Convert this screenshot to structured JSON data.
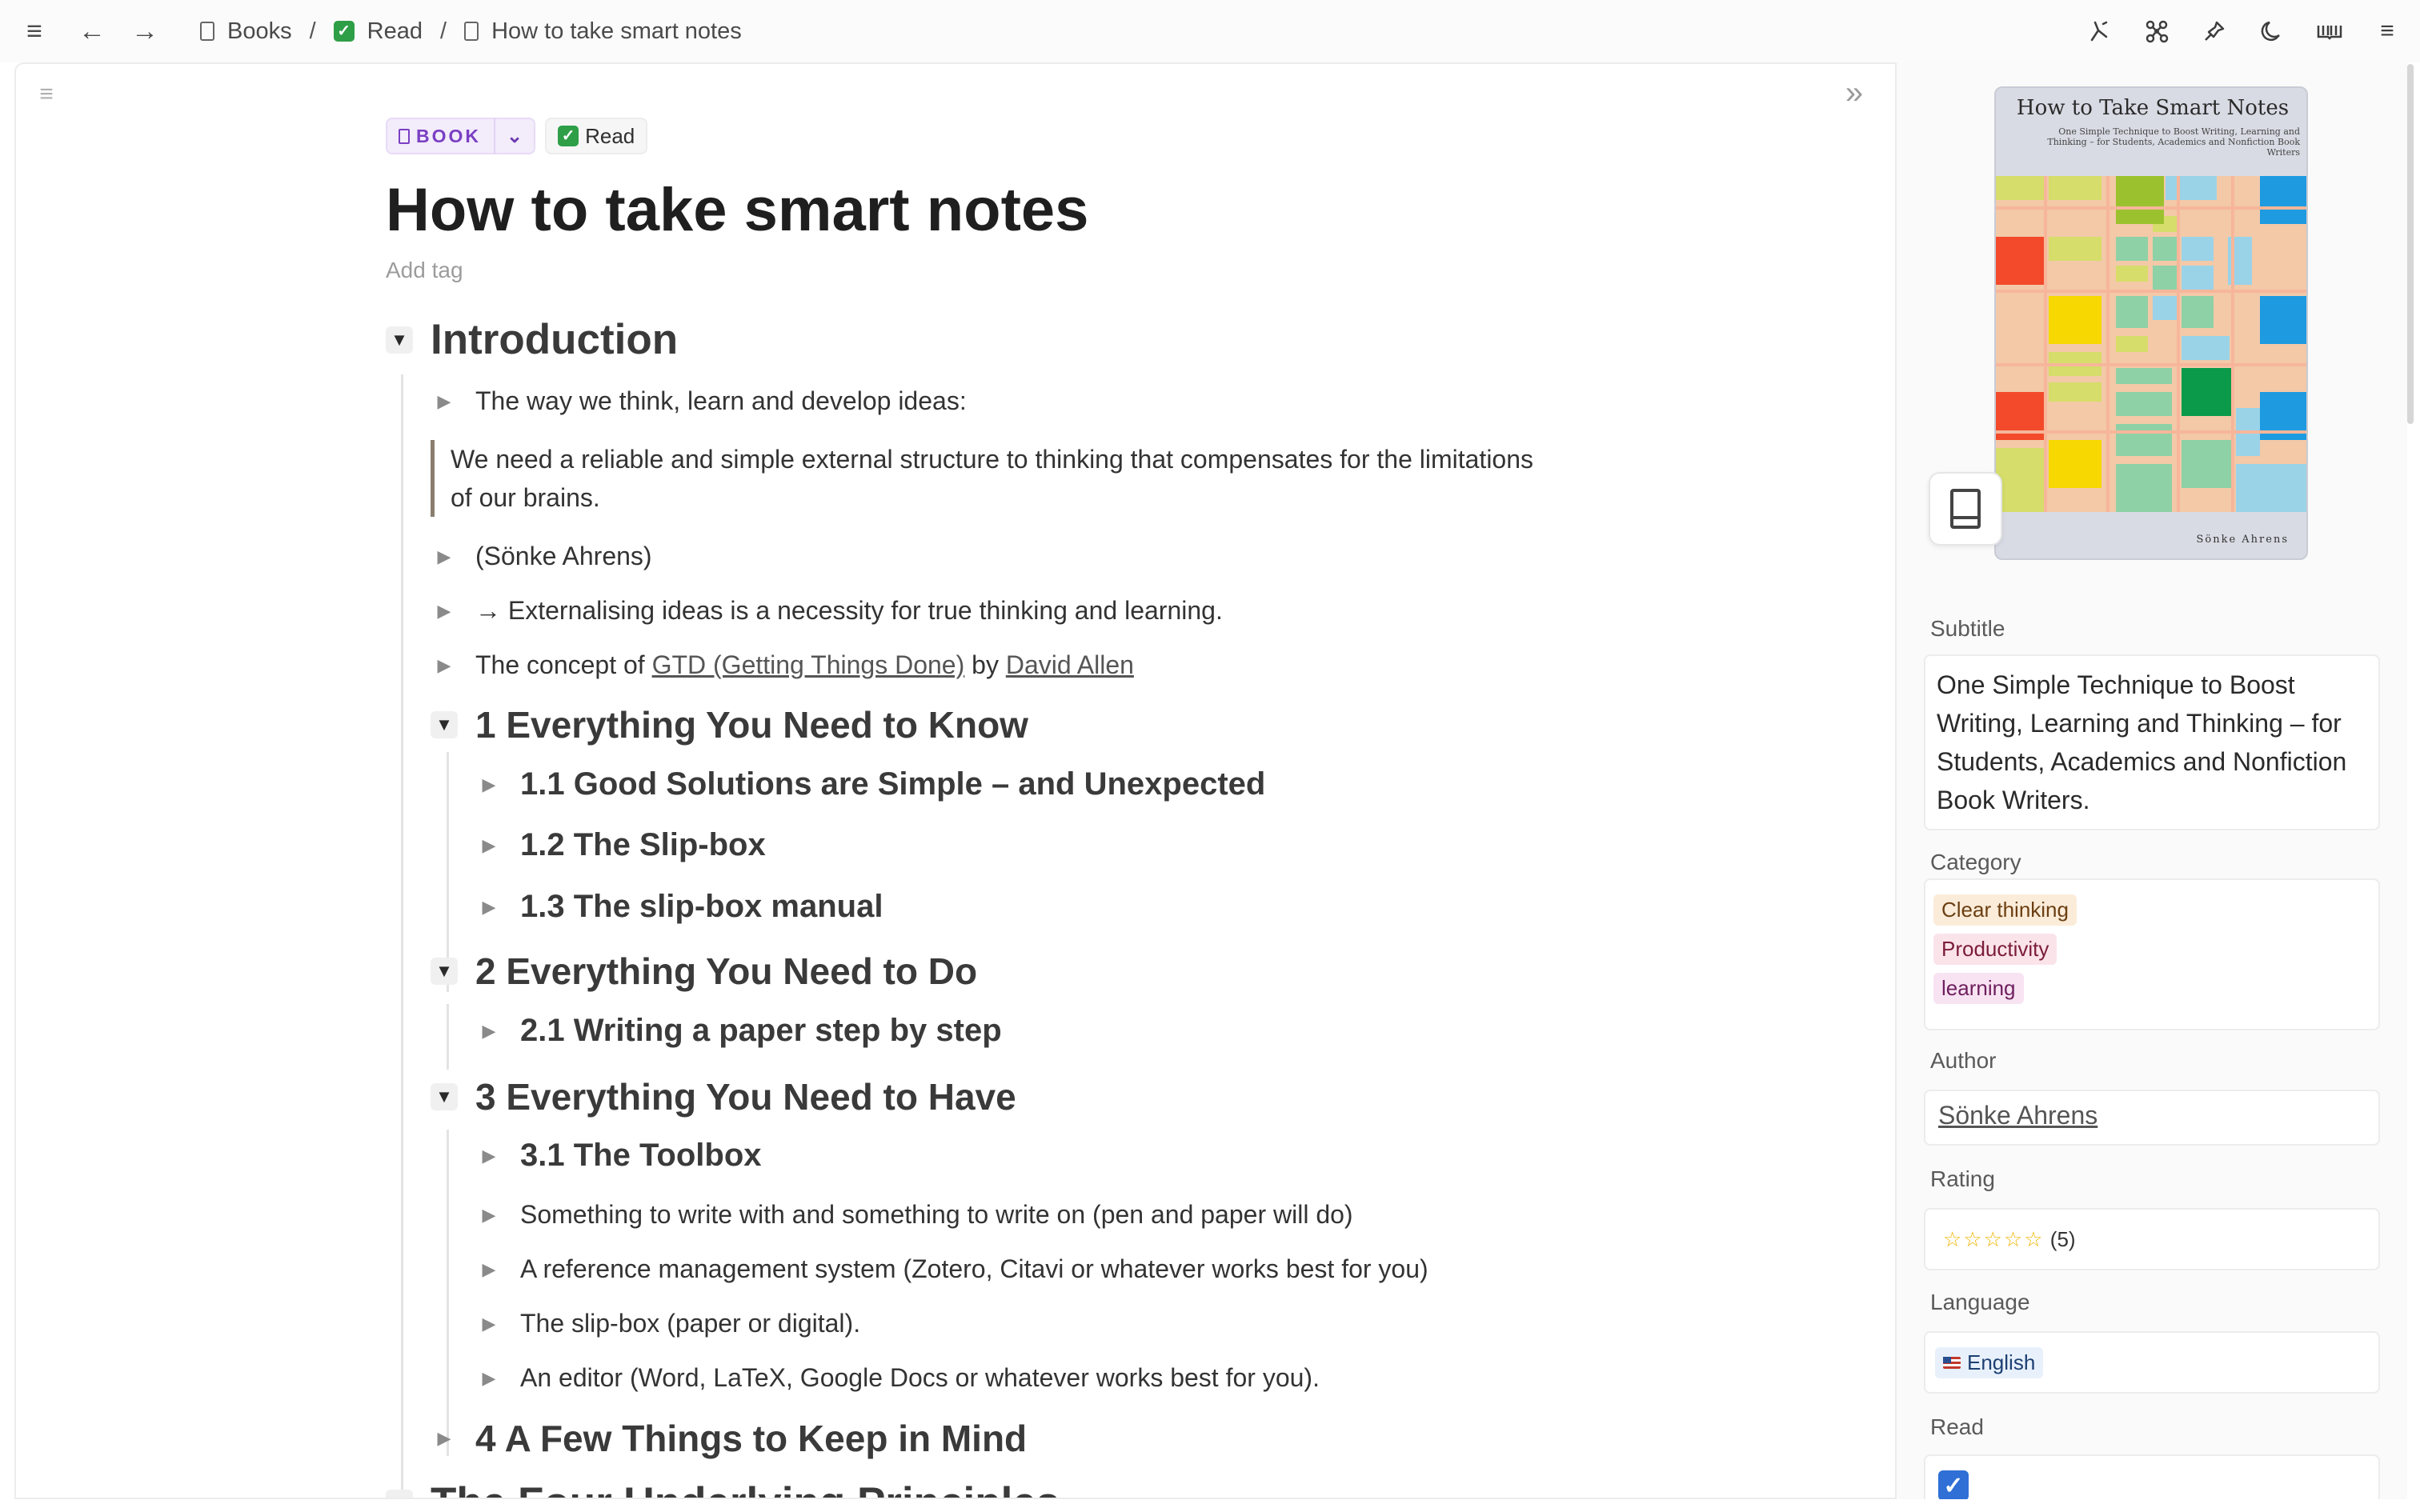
{
  "breadcrumbs": [
    {
      "label": "Books",
      "icon": "page-icon"
    },
    {
      "label": "Read",
      "icon": "check-icon"
    },
    {
      "label": "How to take smart notes",
      "icon": "page-icon"
    }
  ],
  "topbar": {
    "icons_left": [
      "menu-icon",
      "back-arrow-icon",
      "forward-arrow-icon"
    ],
    "icons_right": [
      "routing-icon",
      "graph-icon",
      "pin-icon",
      "moon-icon",
      "reading-icon",
      "hamburger-icon"
    ]
  },
  "page": {
    "type_tag": "BOOK",
    "status_tag": "Read",
    "title": "How to take smart notes",
    "add_tag": "Add tag"
  },
  "outline": {
    "intro": "Introduction",
    "b1": "The way we think, learn and develop ideas:",
    "quote": "We need a reliable and simple external structure to thinking that compensates for the limitations of our brains.",
    "b2": "(Sönke Ahrens)",
    "b3": "→ Externalising ideas is a necessity for true thinking and learning.",
    "b4_pre": "The concept of ",
    "b4_link1": "GTD (Getting Things Done)",
    "b4_mid": " by ",
    "b4_link2": "David Allen",
    "s1": "1 Everything You Need to Know",
    "s1_1": "1.1 Good Solutions are Simple – and Unexpected",
    "s1_2": "1.2 The Slip-box",
    "s1_3": "1.3 The slip-box manual",
    "s2": "2 Everything You Need to Do",
    "s2_1": "2.1 Writing a paper step by step",
    "s3": "3 Everything You Need to Have",
    "s3_1": "3.1 The Toolbox",
    "t1": "Something to write with and something to write on (pen and paper will do)",
    "t2": "A reference management system (Zotero, Citavi or whatever works best for you)",
    "t3": "The slip-box (paper or digital).",
    "t4": "An editor (Word, LaTeX, Google Docs or whatever works best for you).",
    "s4": "4 A Few Things to Keep in Mind",
    "s5": "The Four Underlying Principles"
  },
  "cover": {
    "title": "How to Take Smart Notes",
    "subtitle": "One Simple Technique to Boost Writing, Learning and Thinking – for Students, Academics and Nonfiction Book Writers",
    "author": "Sönke Ahrens"
  },
  "properties": {
    "subtitle_label": "Subtitle",
    "subtitle_value": "One Simple Technique to Boost Writing, Learning and Thinking – for Students, Academics and Nonfiction Book Writers.",
    "category_label": "Category",
    "categories": [
      {
        "label": "Clear thinking",
        "bg": "#fbecd9",
        "fg": "#6b3f12"
      },
      {
        "label": "Productivity",
        "bg": "#fbe3ea",
        "fg": "#7a1c3a"
      },
      {
        "label": "learning",
        "bg": "#f8e3f2",
        "fg": "#6e1f5e"
      }
    ],
    "author_label": "Author",
    "author_value": "Sönke Ahrens",
    "rating_label": "Rating",
    "rating_stars": "☆☆☆☆☆",
    "rating_value": "(5)",
    "language_label": "Language",
    "language_value": "English",
    "read_label": "Read",
    "read_checked": true
  },
  "colors": {
    "accent_purple": "#7a3fc3",
    "check_green": "#2e9e47",
    "checkbox_blue": "#2f6fd6"
  }
}
